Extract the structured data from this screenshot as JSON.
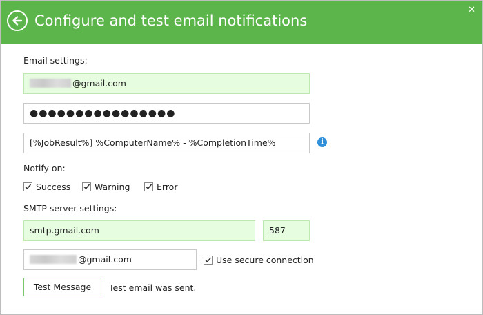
{
  "window": {
    "title": "Configure and test email notifications",
    "close_glyph": "✕"
  },
  "email": {
    "section_label": "Email settings:",
    "address_suffix": "@gmail.com",
    "password_mask": "●●●●●●●●●●●●●●●●",
    "subject": "[%JobResult%] %ComputerName% - %CompletionTime%"
  },
  "notify": {
    "label": "Notify on:",
    "options": [
      {
        "label": "Success",
        "checked": true
      },
      {
        "label": "Warning",
        "checked": true
      },
      {
        "label": "Error",
        "checked": true
      }
    ]
  },
  "smtp": {
    "section_label": "SMTP server settings:",
    "server": "smtp.gmail.com",
    "port": "587",
    "user_suffix": "@gmail.com",
    "secure_label": "Use secure connection",
    "secure_checked": true
  },
  "test": {
    "button_label": "Test Message",
    "status": "Test email was sent."
  },
  "colors": {
    "titlebar": "#5cb54a",
    "field_highlight": "#e6fde0",
    "info": "#2f8fd9"
  }
}
